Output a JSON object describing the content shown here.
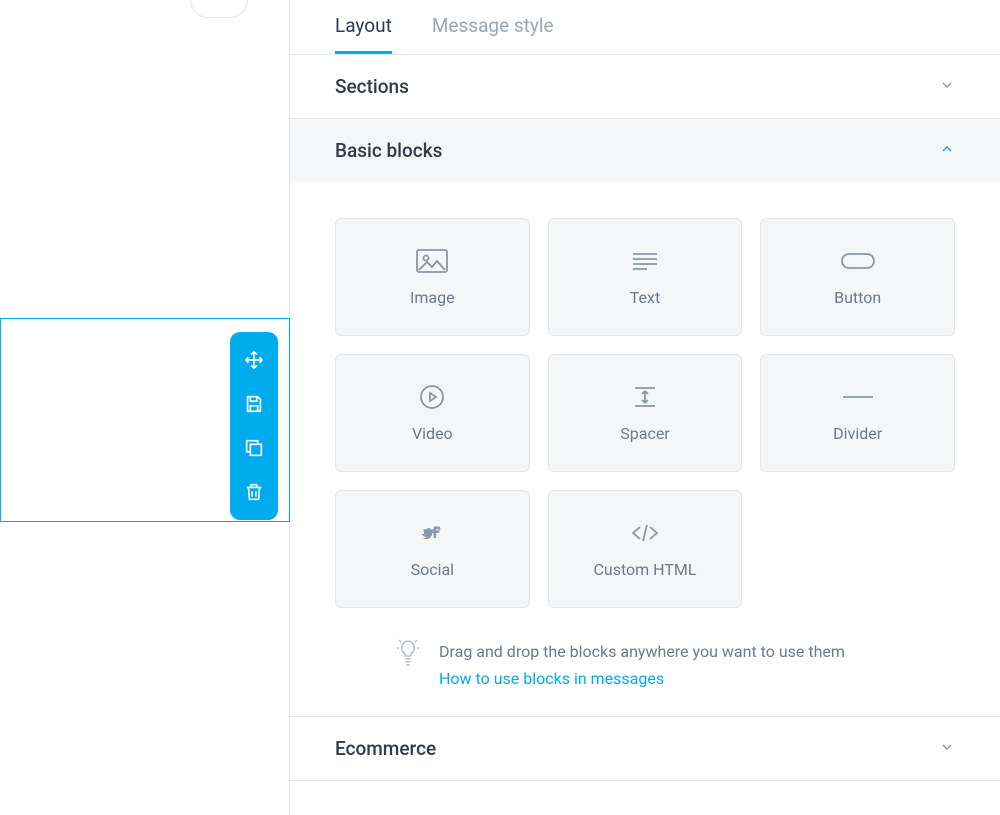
{
  "tabs": {
    "layout": "Layout",
    "message_style": "Message style"
  },
  "accordion": {
    "sections": "Sections",
    "basic_blocks": "Basic blocks",
    "ecommerce": "Ecommerce"
  },
  "blocks": {
    "image": "Image",
    "text": "Text",
    "button": "Button",
    "video": "Video",
    "spacer": "Spacer",
    "divider": "Divider",
    "social": "Social",
    "custom_html": "Custom HTML"
  },
  "tip": {
    "text": "Drag and drop the blocks anywhere you want to use them",
    "link": "How to use blocks in messages"
  }
}
